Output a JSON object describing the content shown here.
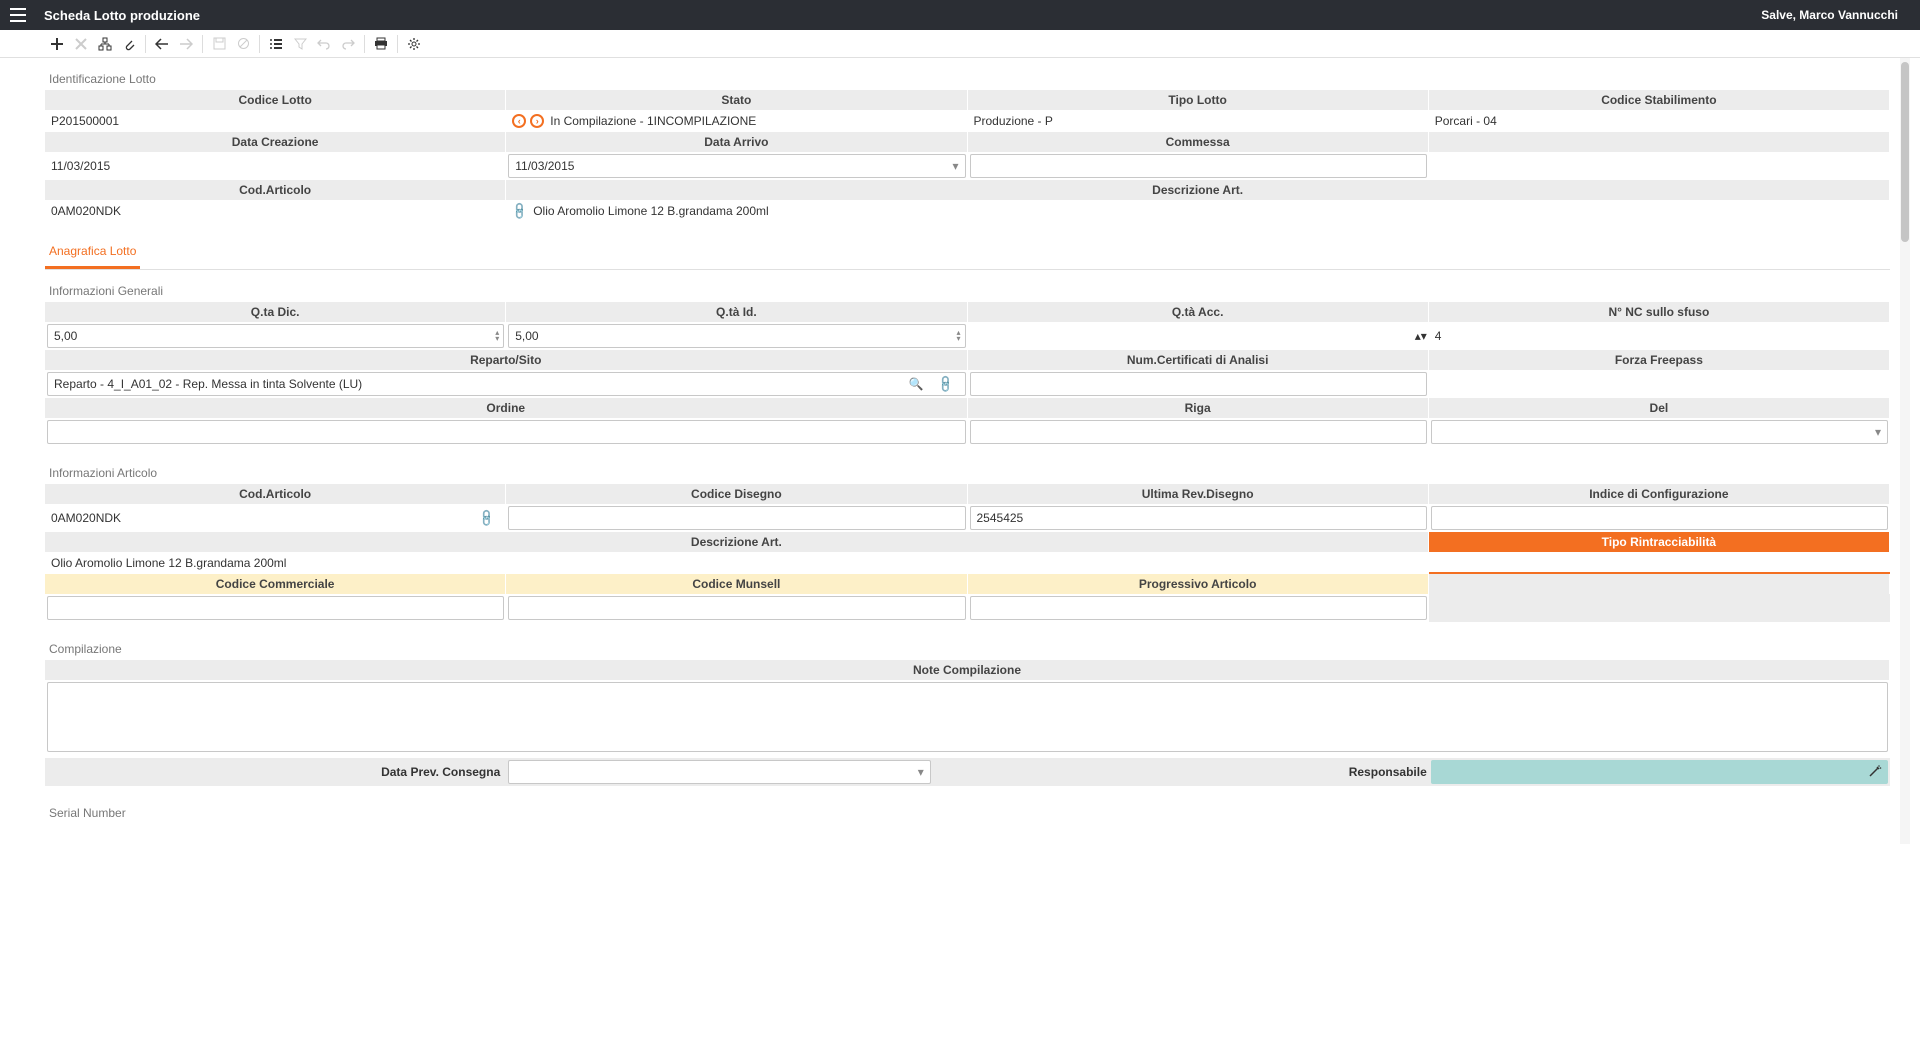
{
  "header": {
    "title": "Scheda Lotto produzione",
    "greeting": "Salve, Marco Vannucchi"
  },
  "identificazione": {
    "section_title": "Identificazione Lotto",
    "labels": {
      "codice_lotto": "Codice Lotto",
      "stato": "Stato",
      "tipo_lotto": "Tipo Lotto",
      "codice_stabilimento": "Codice Stabilimento",
      "data_creazione": "Data Creazione",
      "data_arrivo": "Data Arrivo",
      "commessa": "Commessa",
      "cod_articolo": "Cod.Articolo",
      "descrizione_art": "Descrizione Art."
    },
    "values": {
      "codice_lotto": "P201500001",
      "stato": "In Compilazione - 1INCOMPILAZIONE",
      "tipo_lotto": "Produzione - P",
      "codice_stabilimento": "Porcari - 04",
      "data_creazione": "11/03/2015",
      "data_arrivo": "11/03/2015",
      "commessa": "",
      "cod_articolo": "0AM020NDK",
      "descrizione_art": "Olio Aromolio Limone 12 B.grandama 200ml"
    }
  },
  "tab": {
    "label": "Anagrafica Lotto"
  },
  "generali": {
    "section_title": "Informazioni Generali",
    "labels": {
      "qta_dic": "Q.ta Dic.",
      "qta_id": "Q.tà Id.",
      "qta_acc": "Q.tà Acc.",
      "n_nc": "N° NC sullo sfuso",
      "reparto": "Reparto/Sito",
      "num_cert": "Num.Certificati di Analisi",
      "forza_freepass": "Forza Freepass",
      "ordine": "Ordine",
      "riga": "Riga",
      "del": "Del"
    },
    "values": {
      "qta_dic": "5,00",
      "qta_id": "5,00",
      "qta_acc": "",
      "n_nc": "4",
      "reparto": "Reparto - 4_I_A01_02 - Rep. Messa in tinta Solvente (LU)",
      "num_cert": "",
      "ordine": "",
      "riga": "",
      "del": ""
    }
  },
  "articolo": {
    "section_title": "Informazioni Articolo",
    "labels": {
      "cod_articolo": "Cod.Articolo",
      "codice_disegno": "Codice Disegno",
      "ultima_rev": "Ultima Rev.Disegno",
      "indice_config": "Indice di Configurazione",
      "descrizione_art": "Descrizione Art.",
      "tipo_rintr": "Tipo Rintracciabilità",
      "codice_commerciale": "Codice Commerciale",
      "codice_munsell": "Codice Munsell",
      "progressivo": "Progressivo Articolo"
    },
    "values": {
      "cod_articolo": "0AM020NDK",
      "codice_disegno": "",
      "ultima_rev": "2545425",
      "indice_config": "",
      "descrizione_art": "Olio Aromolio Limone 12 B.grandama 200ml",
      "codice_commerciale": "",
      "codice_munsell": "",
      "progressivo": ""
    }
  },
  "compilazione": {
    "section_title": "Compilazione",
    "labels": {
      "note": "Note Compilazione",
      "data_prev": "Data Prev. Consegna",
      "responsabile": "Responsabile"
    }
  },
  "serial": {
    "section_title": "Serial Number"
  }
}
